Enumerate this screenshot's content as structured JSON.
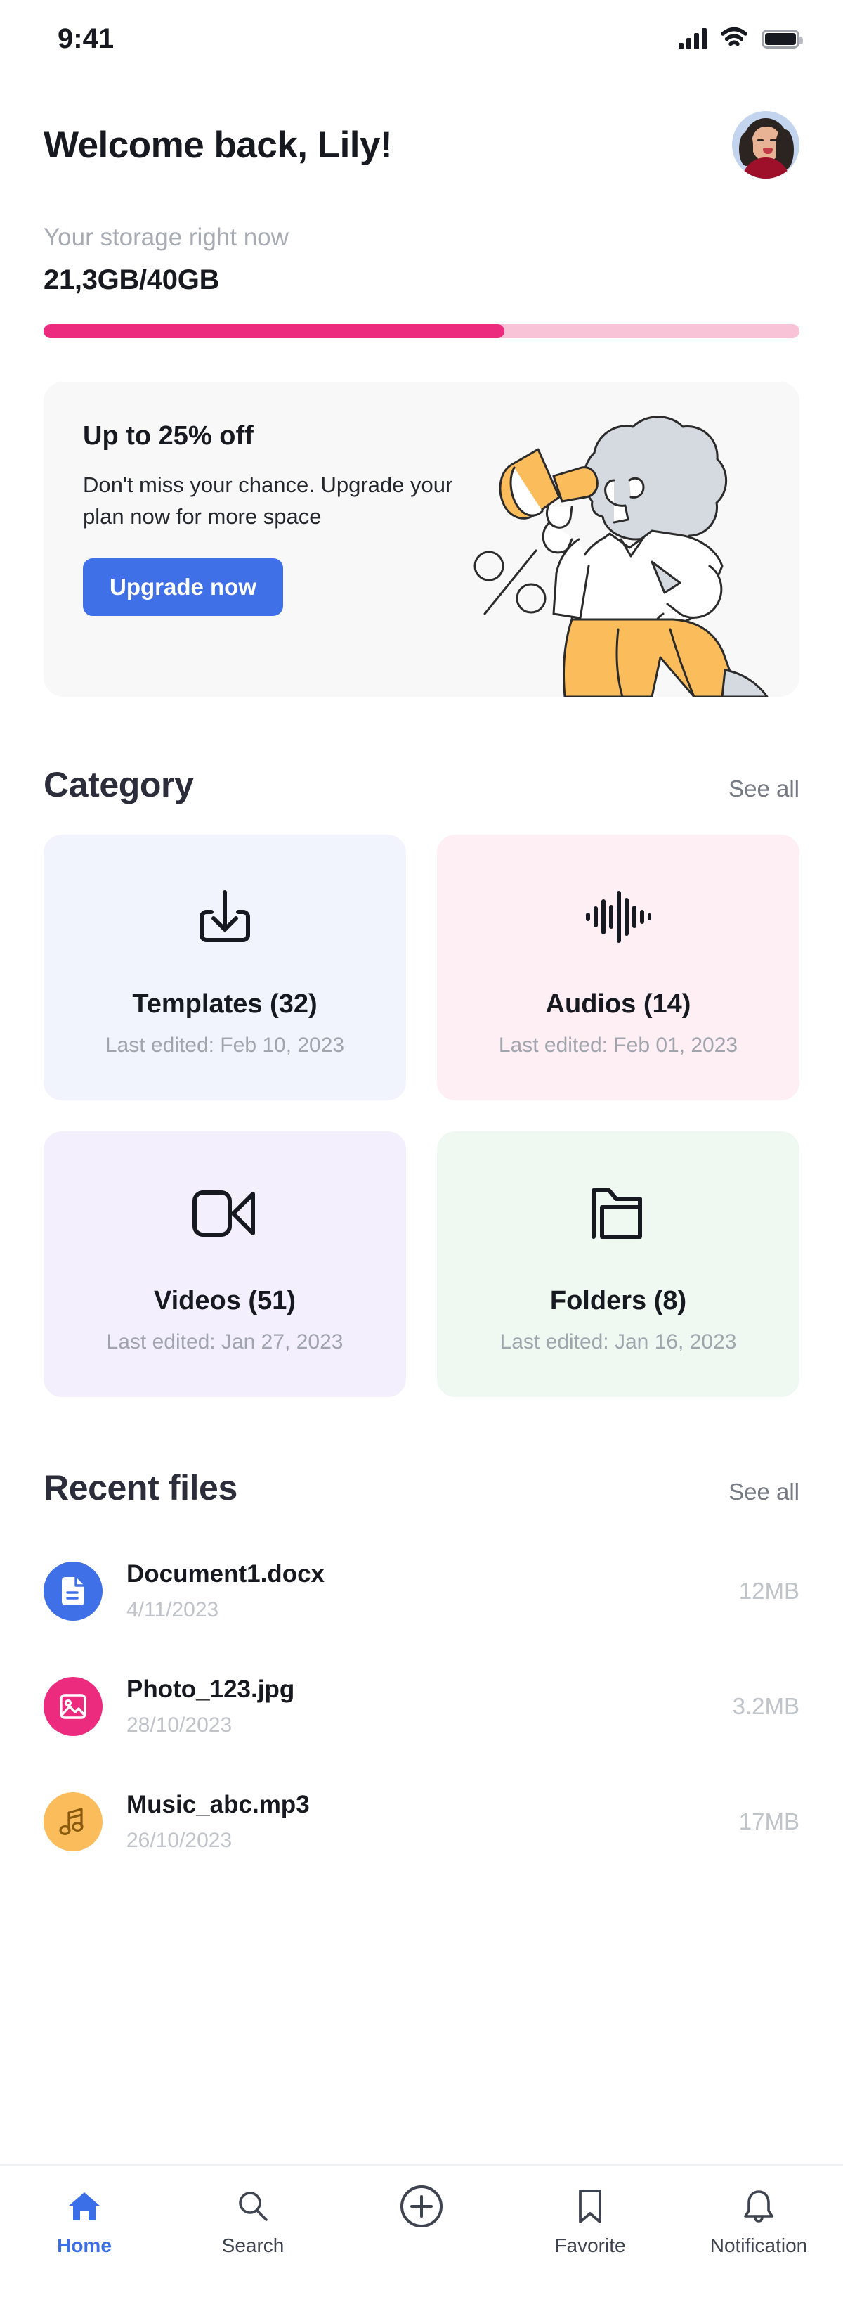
{
  "status_bar": {
    "time": "9:41",
    "cellular_icon": "signal-bars-icon",
    "wifi_icon": "wifi-icon",
    "battery_icon": "battery-icon"
  },
  "header": {
    "title": "Welcome back, Lily!",
    "avatar_icon": "avatar"
  },
  "storage": {
    "label": "Your storage right now",
    "value": "21,3GB/40GB",
    "used_percent": 61,
    "fill_color": "#EC2B7F",
    "track_color": "#F8C2D7"
  },
  "promo": {
    "title": "Up to 25% off",
    "subtitle": "Don't miss your chance. Upgrade your plan now for more space",
    "button_label": "Upgrade now",
    "button_color": "#4070E8",
    "background": "#F8F8F9",
    "illustration": "woman-with-megaphone-illustration"
  },
  "category": {
    "title": "Category",
    "see_all_label": "See all",
    "cards": [
      {
        "name": "Templates (32)",
        "meta": "Last edited: Feb 10, 2023",
        "icon": "download-icon",
        "bg": "#F1F4FD"
      },
      {
        "name": "Audios (14)",
        "meta": "Last edited: Feb 01, 2023",
        "icon": "audio-waveform-icon",
        "bg": "#FDEFF4"
      },
      {
        "name": "Videos (51)",
        "meta": "Last edited: Jan 27, 2023",
        "icon": "video-camera-icon",
        "bg": "#F4EFFD"
      },
      {
        "name": "Folders (8)",
        "meta": "Last edited: Jan 16, 2023",
        "icon": "folder-icon",
        "bg": "#EFF9F1"
      }
    ]
  },
  "recent_files": {
    "title": "Recent files",
    "see_all_label": "See all",
    "files": [
      {
        "name": "Document1.docx",
        "date": "4/11/2023",
        "size": "12MB",
        "icon": "document-icon",
        "badge_color": "#4070E8"
      },
      {
        "name": "Photo_123.jpg",
        "date": "28/10/2023",
        "size": "3.2MB",
        "icon": "image-icon",
        "badge_color": "#EC2B7F"
      },
      {
        "name": "Music_abc.mp3",
        "date": "26/10/2023",
        "size": "17MB",
        "icon": "music-note-icon",
        "badge_color": "#FBBC5B"
      }
    ]
  },
  "bottom_nav": {
    "active_color": "#3B6FE8",
    "items": [
      {
        "label": "Home",
        "icon": "home-icon",
        "active": true
      },
      {
        "label": "Search",
        "icon": "search-icon",
        "active": false
      },
      {
        "label": "",
        "icon": "plus-circle-icon",
        "active": false
      },
      {
        "label": "Favorite",
        "icon": "bookmark-icon",
        "active": false
      },
      {
        "label": "Notification",
        "icon": "bell-icon",
        "active": false
      }
    ]
  }
}
